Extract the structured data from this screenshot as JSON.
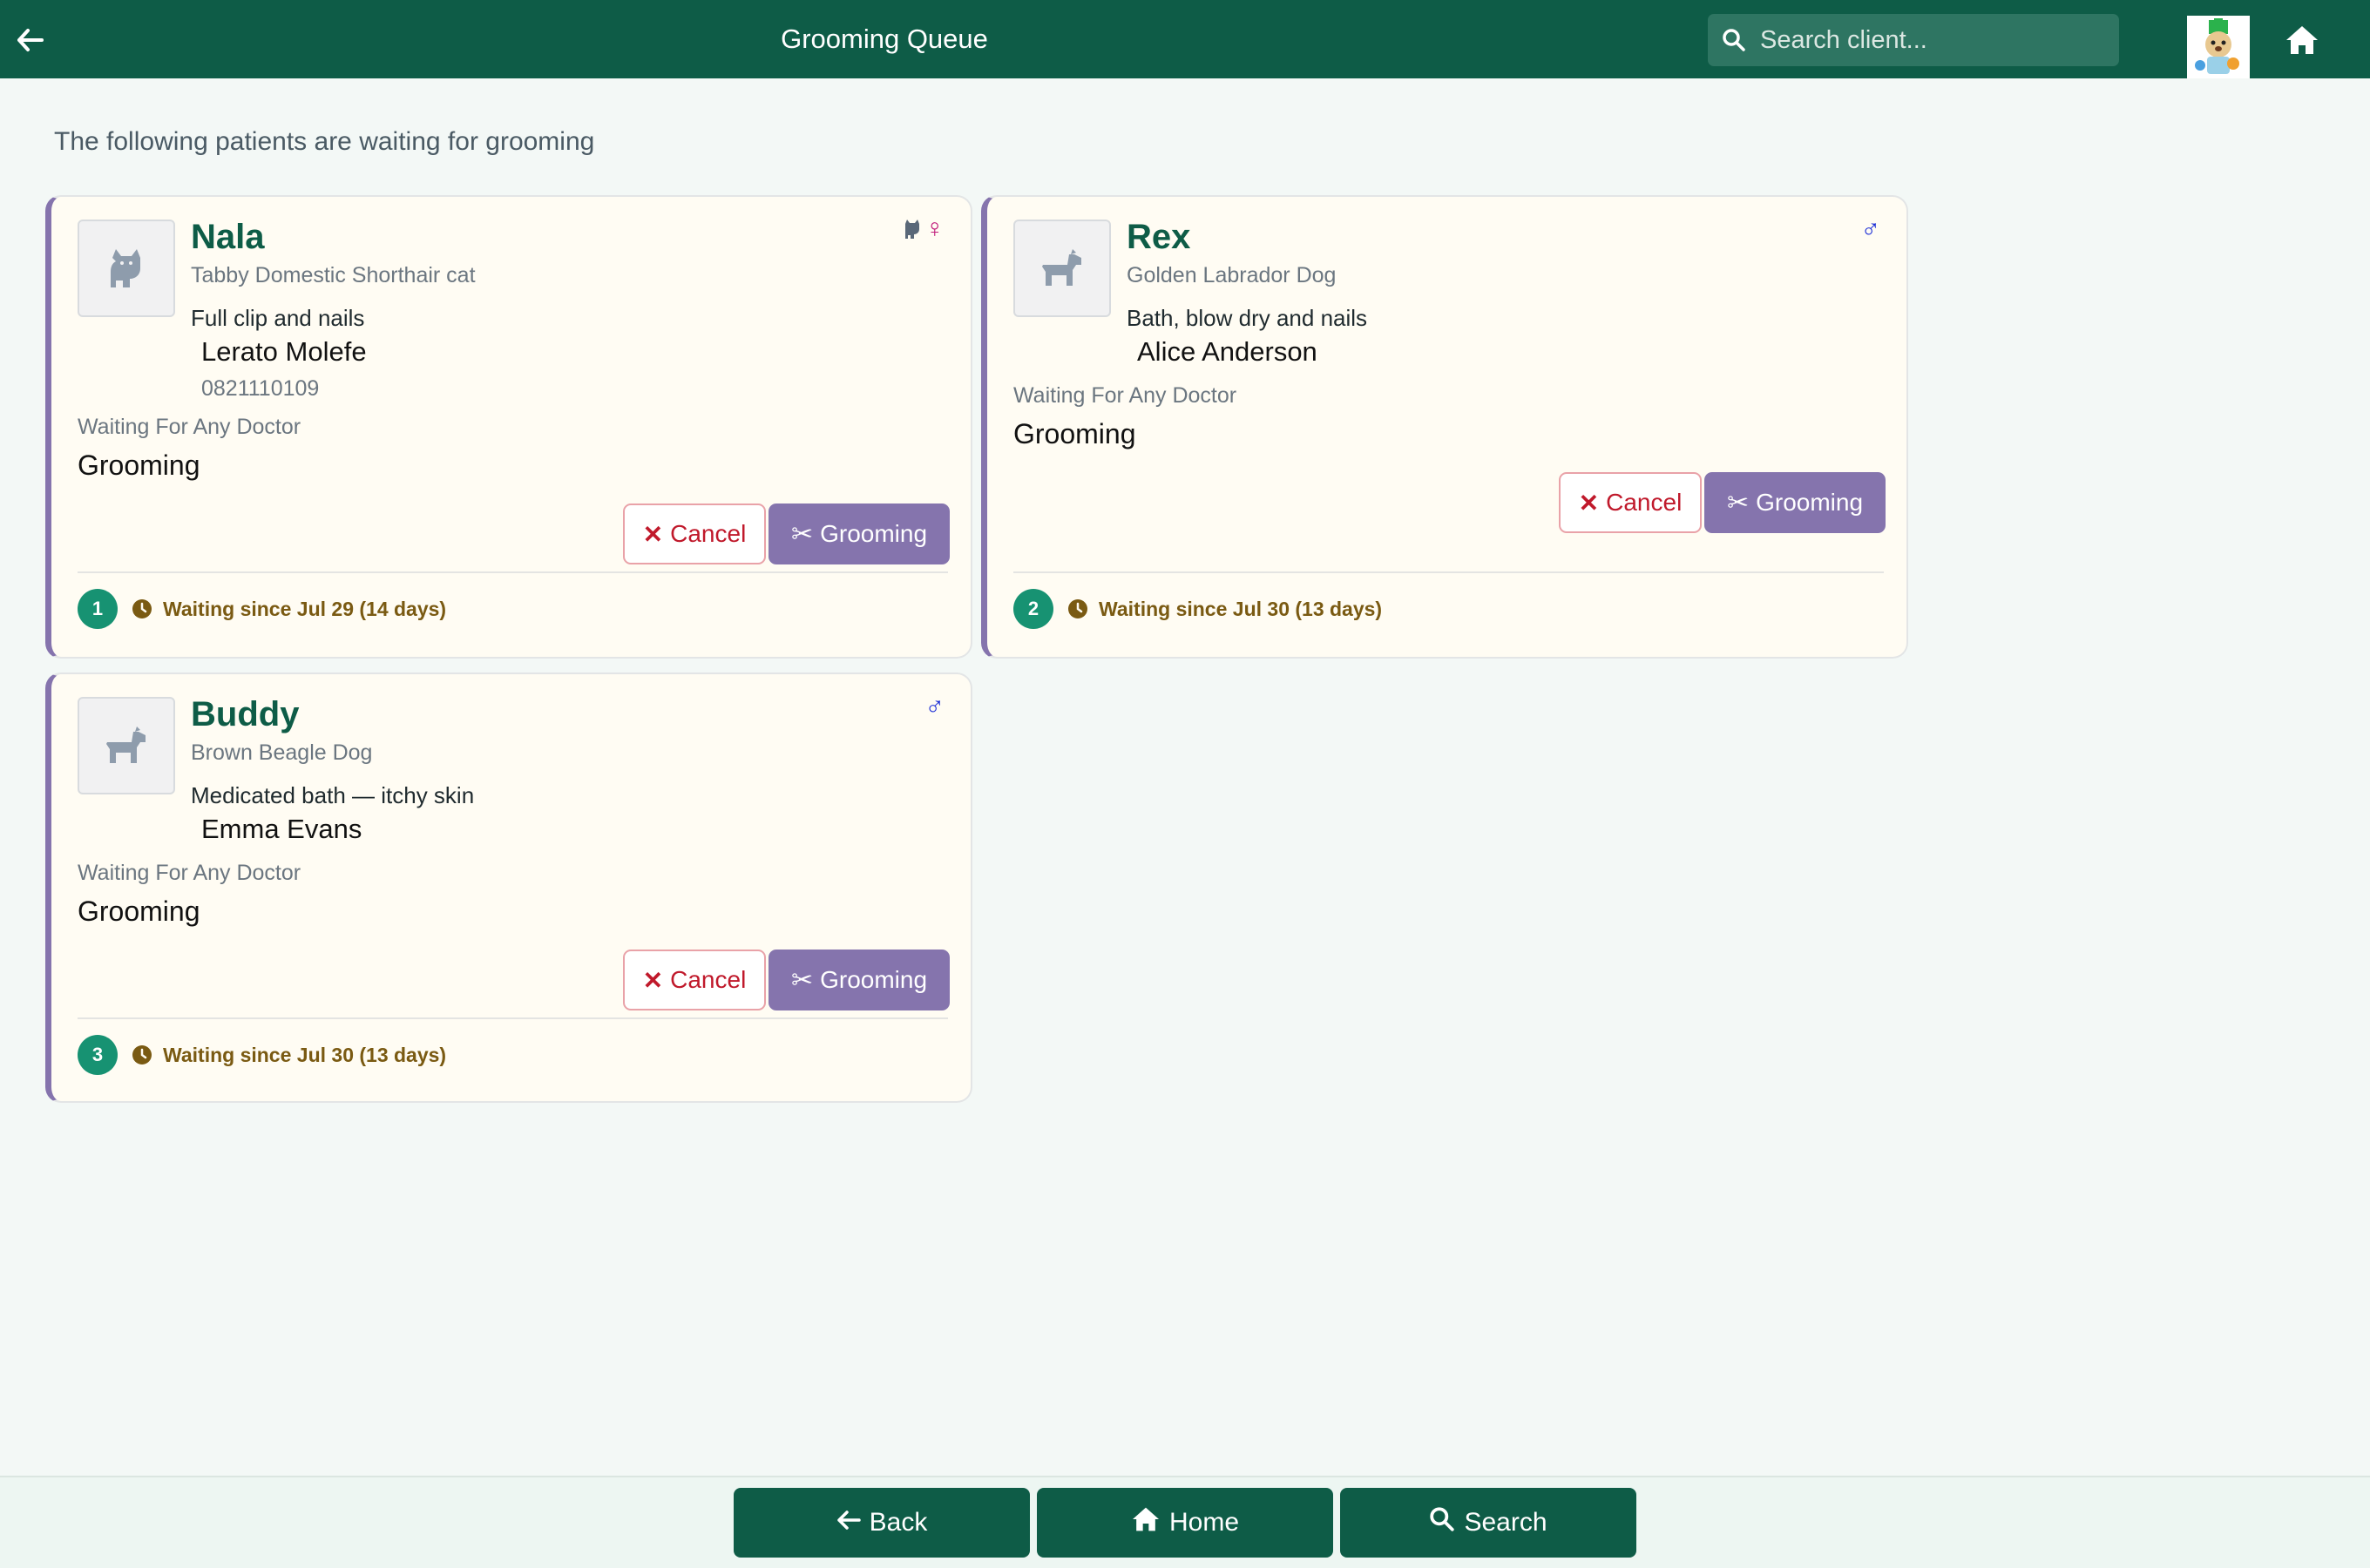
{
  "header": {
    "title": "Grooming Queue",
    "search_placeholder": "Search client...",
    "icons": [
      "arrow-left-icon",
      "search-icon",
      "clinic-logo",
      "home-icon"
    ]
  },
  "intro": "The following patients are waiting for grooming",
  "colors": {
    "primary": "#0e5c47",
    "accent": "#8574ad",
    "card_bg": "#fffcf3",
    "cancel": "#c0192b",
    "badge": "#179272",
    "waiting_text": "#7a5a12",
    "male": "#1d2fd6",
    "female": "#c01a7a"
  },
  "patients": [
    {
      "name": "Nala",
      "species_icon": "cat-icon",
      "breed": "Tabby Domestic Shorthair cat",
      "service": "Full clip and nails",
      "owner": "Lerato Molefe",
      "phone": "0821110109",
      "waiting_for": "Waiting For Any Doctor",
      "queue_type": "Grooming",
      "sex_icons": [
        "cat-icon",
        "female-icon"
      ],
      "sex_symbol": "♀",
      "cancel_label": "Cancel",
      "groom_label": "Grooming",
      "queue_number": "1",
      "waiting_since": "Waiting since Jul 29 (14 days)"
    },
    {
      "name": "Rex",
      "species_icon": "dog-icon",
      "breed": "Golden Labrador Dog",
      "service": "Bath, blow dry and nails",
      "owner": "Alice Anderson",
      "waiting_for": "Waiting For Any Doctor",
      "queue_type": "Grooming",
      "sex_icons": [
        "male-icon"
      ],
      "sex_symbol": "♂",
      "cancel_label": "Cancel",
      "groom_label": "Grooming",
      "queue_number": "2",
      "waiting_since": "Waiting since Jul 30 (13 days)"
    },
    {
      "name": "Buddy",
      "species_icon": "dog-icon",
      "breed": "Brown Beagle Dog",
      "service": "Medicated bath — itchy skin",
      "owner": "Emma Evans",
      "waiting_for": "Waiting For Any Doctor",
      "queue_type": "Grooming",
      "sex_icons": [
        "male-icon"
      ],
      "sex_symbol": "♂",
      "cancel_label": "Cancel",
      "groom_label": "Grooming",
      "queue_number": "3",
      "waiting_since": "Waiting since Jul 30 (13 days)"
    }
  ],
  "bottom_nav": {
    "back": "Back",
    "home": "Home",
    "search": "Search"
  }
}
